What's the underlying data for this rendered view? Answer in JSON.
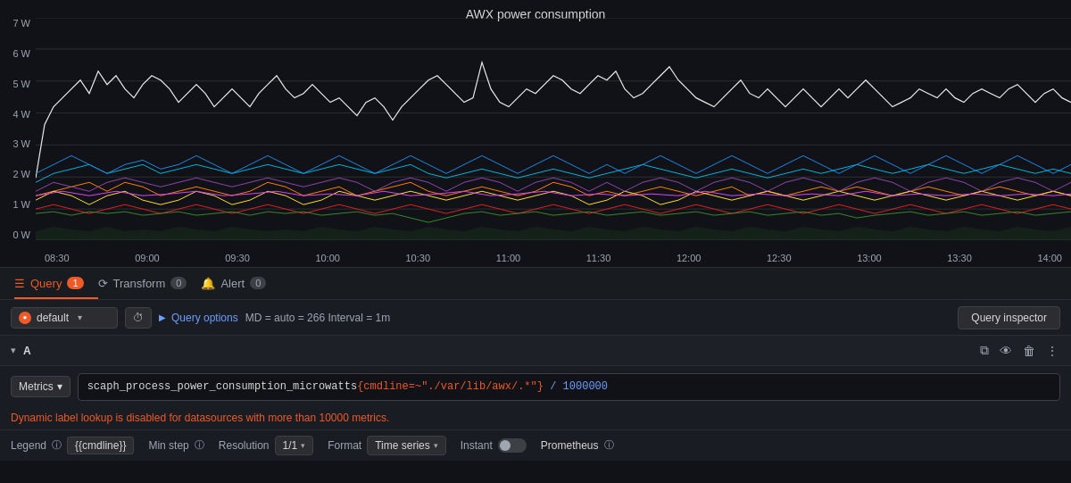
{
  "chart": {
    "title": "AWX power consumption",
    "y_axis": [
      "7 W",
      "6 W",
      "5 W",
      "4 W",
      "3 W",
      "2 W",
      "1 W",
      "0 W"
    ],
    "x_axis": [
      "08:30",
      "09:00",
      "09:30",
      "10:00",
      "10:30",
      "11:00",
      "11:30",
      "12:00",
      "12:30",
      "13:00",
      "13:30",
      "14:00"
    ]
  },
  "tabs": {
    "query": {
      "label": "Query",
      "count": "1",
      "active": true
    },
    "transform": {
      "label": "Transform",
      "count": "0"
    },
    "alert": {
      "label": "Alert",
      "count": "0"
    }
  },
  "query_bar": {
    "datasource": "default",
    "history_tooltip": "Query history",
    "query_options_label": "Query options",
    "query_options_meta": "MD = auto = 266   Interval = 1m",
    "query_inspector_label": "Query inspector"
  },
  "query_editor": {
    "letter": "A",
    "metrics_label": "Metrics",
    "metrics_chevron": "▾",
    "expression": "scaph_process_power_consumption_microwatts",
    "expression_selector": "{cmdline=~\"./var/lib/awx/.*\"}",
    "expression_math": " / 1000000",
    "warning": "Dynamic label lookup is disabled for datasources with more than 10000 metrics.",
    "legend_label": "Legend",
    "legend_value": "{{cmdline}}",
    "min_step_label": "Min step",
    "resolution_label": "Resolution",
    "resolution_value": "1/1",
    "format_label": "Format",
    "format_value": "Time series",
    "instant_label": "Instant",
    "prometheus_label": "Prometheus"
  },
  "icons": {
    "query_icon": "☰",
    "transform_icon": "⟳",
    "alert_icon": "🔔",
    "chevron_right": "▶",
    "chevron_down": "▾",
    "history": "⏱",
    "copy": "⧉",
    "eye": "👁",
    "trash": "🗑",
    "dots": "⋮",
    "info": "ⓘ"
  }
}
